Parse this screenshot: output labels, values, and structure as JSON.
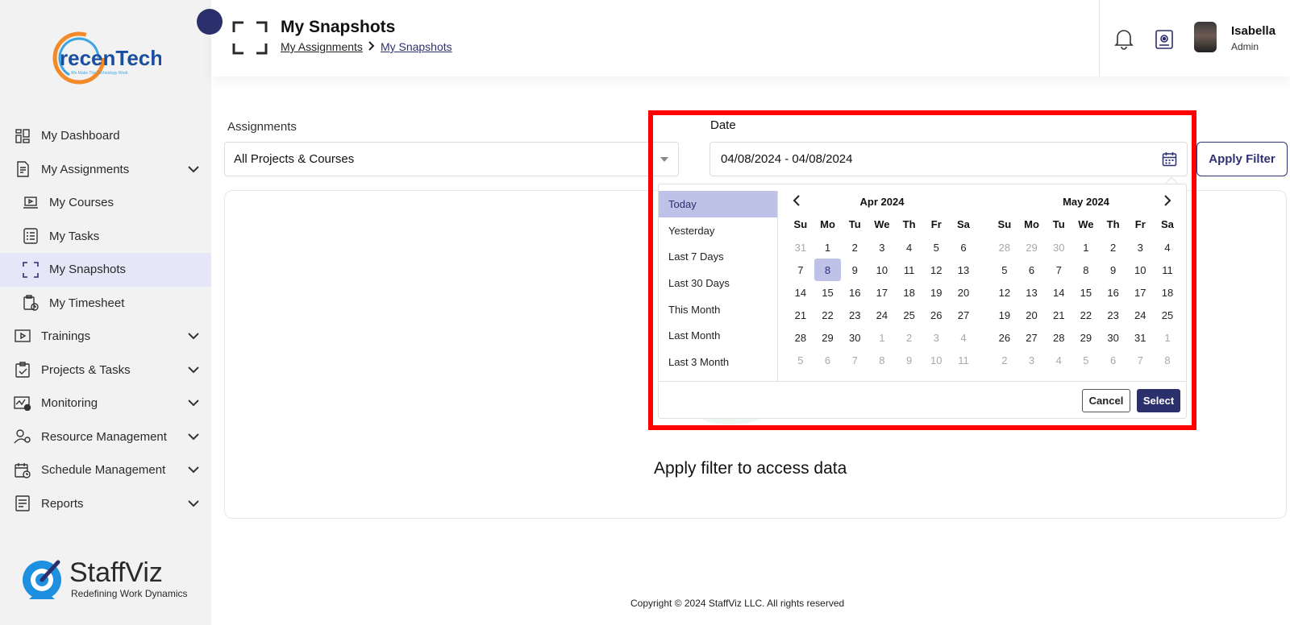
{
  "brand": {
    "logo_text": "recenTech",
    "logo_tagline": "We Make The Technology Work",
    "bottom_logo_name": "StaffViz",
    "bottom_logo_tagline": "Redefining Work Dynamics"
  },
  "sidebar": {
    "items": [
      {
        "label": "My Dashboard",
        "icon": "dashboard-icon",
        "sub": false,
        "chevron": false,
        "active": false
      },
      {
        "label": "My Assignments",
        "icon": "assignments-icon",
        "sub": false,
        "chevron": true,
        "active": false
      },
      {
        "label": "My Courses",
        "icon": "courses-icon",
        "sub": true,
        "chevron": false,
        "active": false
      },
      {
        "label": "My Tasks",
        "icon": "tasks-icon",
        "sub": true,
        "chevron": false,
        "active": false
      },
      {
        "label": "My Snapshots",
        "icon": "snapshots-icon",
        "sub": true,
        "chevron": false,
        "active": true
      },
      {
        "label": "My Timesheet",
        "icon": "timesheet-icon",
        "sub": true,
        "chevron": false,
        "active": false
      },
      {
        "label": "Trainings",
        "icon": "trainings-icon",
        "sub": false,
        "chevron": true,
        "active": false
      },
      {
        "label": "Projects & Tasks",
        "icon": "projects-icon",
        "sub": false,
        "chevron": true,
        "active": false
      },
      {
        "label": "Monitoring",
        "icon": "monitoring-icon",
        "sub": false,
        "chevron": true,
        "active": false
      },
      {
        "label": "Resource Management",
        "icon": "resource-icon",
        "sub": false,
        "chevron": true,
        "active": false
      },
      {
        "label": "Schedule Management",
        "icon": "schedule-icon",
        "sub": false,
        "chevron": true,
        "active": false
      },
      {
        "label": "Reports",
        "icon": "reports-icon",
        "sub": false,
        "chevron": true,
        "active": false
      }
    ]
  },
  "header": {
    "title": "My Snapshots",
    "breadcrumb": [
      "My Assignments",
      "My Snapshots"
    ],
    "user_name": "Isabella",
    "user_role": "Admin"
  },
  "filters": {
    "assignments_label": "Assignments",
    "assignments_value": "All Projects & Courses",
    "date_label": "Date",
    "date_value": "04/08/2024 - 04/08/2024",
    "apply_label": "Apply Filter"
  },
  "datepicker": {
    "ranges": [
      "Today",
      "Yesterday",
      "Last 7 Days",
      "Last 30 Days",
      "This Month",
      "Last Month",
      "Last 3 Month"
    ],
    "active_range": 0,
    "weekdays": [
      "Su",
      "Mo",
      "Tu",
      "We",
      "Th",
      "Fr",
      "Sa"
    ],
    "calendars": [
      {
        "title": "Apr 2024",
        "days": [
          [
            "31",
            true
          ],
          [
            "1",
            false
          ],
          [
            "2",
            false
          ],
          [
            "3",
            false
          ],
          [
            "4",
            false
          ],
          [
            "5",
            false
          ],
          [
            "6",
            false
          ],
          [
            "7",
            false
          ],
          [
            "8",
            false
          ],
          [
            "9",
            false
          ],
          [
            "10",
            false
          ],
          [
            "11",
            false
          ],
          [
            "12",
            false
          ],
          [
            "13",
            false
          ],
          [
            "14",
            false
          ],
          [
            "15",
            false
          ],
          [
            "16",
            false
          ],
          [
            "17",
            false
          ],
          [
            "18",
            false
          ],
          [
            "19",
            false
          ],
          [
            "20",
            false
          ],
          [
            "21",
            false
          ],
          [
            "22",
            false
          ],
          [
            "23",
            false
          ],
          [
            "24",
            false
          ],
          [
            "25",
            false
          ],
          [
            "26",
            false
          ],
          [
            "27",
            false
          ],
          [
            "28",
            false
          ],
          [
            "29",
            false
          ],
          [
            "30",
            false
          ],
          [
            "1",
            true
          ],
          [
            "2",
            true
          ],
          [
            "3",
            true
          ],
          [
            "4",
            true
          ],
          [
            "5",
            true
          ],
          [
            "6",
            true
          ],
          [
            "7",
            true
          ],
          [
            "8",
            true
          ],
          [
            "9",
            true
          ],
          [
            "10",
            true
          ],
          [
            "11",
            true
          ]
        ],
        "selected_index": 8
      },
      {
        "title": "May 2024",
        "days": [
          [
            "28",
            true
          ],
          [
            "29",
            true
          ],
          [
            "30",
            true
          ],
          [
            "1",
            false
          ],
          [
            "2",
            false
          ],
          [
            "3",
            false
          ],
          [
            "4",
            false
          ],
          [
            "5",
            false
          ],
          [
            "6",
            false
          ],
          [
            "7",
            false
          ],
          [
            "8",
            false
          ],
          [
            "9",
            false
          ],
          [
            "10",
            false
          ],
          [
            "11",
            false
          ],
          [
            "12",
            false
          ],
          [
            "13",
            false
          ],
          [
            "14",
            false
          ],
          [
            "15",
            false
          ],
          [
            "16",
            false
          ],
          [
            "17",
            false
          ],
          [
            "18",
            false
          ],
          [
            "19",
            false
          ],
          [
            "20",
            false
          ],
          [
            "21",
            false
          ],
          [
            "22",
            false
          ],
          [
            "23",
            false
          ],
          [
            "24",
            false
          ],
          [
            "25",
            false
          ],
          [
            "26",
            false
          ],
          [
            "27",
            false
          ],
          [
            "28",
            false
          ],
          [
            "29",
            false
          ],
          [
            "30",
            false
          ],
          [
            "31",
            false
          ],
          [
            "1",
            true
          ],
          [
            "2",
            true
          ],
          [
            "3",
            true
          ],
          [
            "4",
            true
          ],
          [
            "5",
            true
          ],
          [
            "6",
            true
          ],
          [
            "7",
            true
          ],
          [
            "8",
            true
          ]
        ],
        "selected_index": -1
      }
    ],
    "cancel_label": "Cancel",
    "select_label": "Select"
  },
  "content": {
    "empty_message": "Apply filter to access data"
  },
  "footer": {
    "copyright": "Copyright © 2024 StaffViz LLC. All rights reserved"
  },
  "colors": {
    "brand_navy": "#2b2f6b",
    "highlight": "#bec1e8",
    "active_nav": "#e5e6f8",
    "annotation_red": "#ff0000"
  }
}
